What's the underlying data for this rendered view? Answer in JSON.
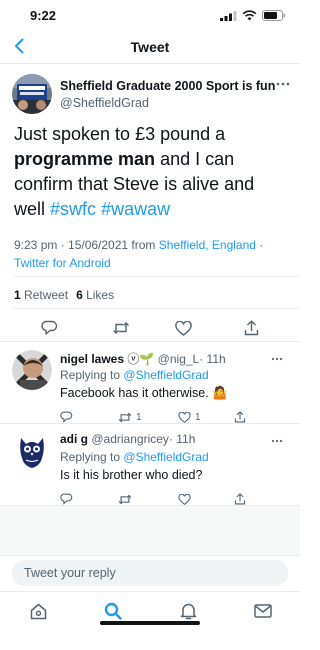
{
  "status_bar": {
    "time": "9:22"
  },
  "nav": {
    "title": "Tweet"
  },
  "main_tweet": {
    "author_name": "Sheffield Graduate 2000 Sport is fun",
    "author_handle": "@SheffieldGrad",
    "text_part1": "Just spoken to £3 pound a",
    "text_bold": "programme man",
    "text_part2": "and I can confirm that Steve is alive and well",
    "hashtag1": "#swfc",
    "hashtag2": "#wawaw",
    "time": "9:23 pm · 15/06/2021 from",
    "location": "Sheffield, England",
    "separator": " ·",
    "client": "Twitter for Android",
    "retweet_count": "1",
    "retweet_label": "Retweet",
    "like_count": "6",
    "like_label": "Likes"
  },
  "replies": [
    {
      "name": "nigel lawes",
      "badges": "ⓥ🌱",
      "handle": "@nig_L",
      "age": "· 11h",
      "replying_prefix": "Replying to",
      "replying_to": "@SheffieldGrad",
      "text": "Facebook has it otherwise. 🤷",
      "retweet_count": "1",
      "like_count": "1"
    },
    {
      "name": "adi g",
      "badges": "",
      "handle": "@adriangricey",
      "age": "· 11h",
      "replying_prefix": "Replying to",
      "replying_to": "@SheffieldGrad",
      "text": "Is it his brother who died?",
      "retweet_count": "",
      "like_count": ""
    }
  ],
  "compose": {
    "placeholder": "Tweet your reply"
  },
  "colors": {
    "accent": "#1d9bf0",
    "text": "#0f1419",
    "muted": "#536471",
    "border": "#e6ecf0"
  }
}
